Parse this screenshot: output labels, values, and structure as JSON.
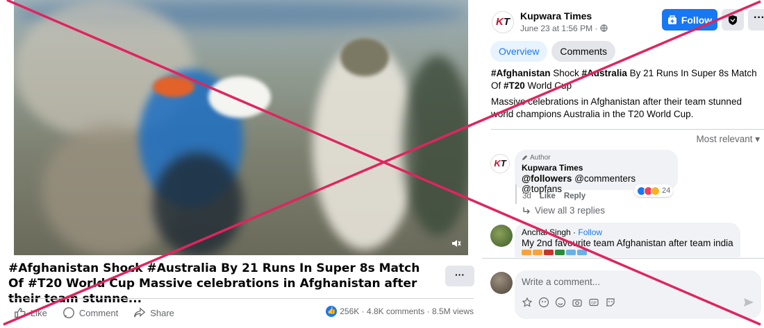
{
  "video": {
    "volume_icon": "speaker-muted-icon"
  },
  "post": {
    "title": "#Afghanistan Shock #Australia By 21 Runs In Super 8s Match Of #T20 World Cup Massive celebrations in Afghanistan after their team stunne...",
    "more_label": "···",
    "actions": {
      "like": "Like",
      "comment": "Comment",
      "share": "Share"
    },
    "stats": "256K · 4.8K comments · 8.5M views"
  },
  "panel": {
    "page_name": "Kupwara Times",
    "logo_text_k": "K",
    "logo_text_t": "T",
    "post_meta": "June 23 at 1:56 PM · ",
    "follow_label": "Follow",
    "dots_label": "···",
    "tabs": [
      "Overview",
      "Comments"
    ],
    "headline_parts": [
      "#Afghanistan",
      " Shock ",
      "#Australia",
      " By 21 Runs In Super 8s Match Of ",
      "#T20",
      " World Cup"
    ],
    "description": "Massive celebrations in Afghanistan after their team stunned world champions Australia in the T20 World Cup.",
    "sort_label": "Most relevant ▾",
    "comments": [
      {
        "author_tag": "Author",
        "name": "Kupwara Times",
        "mention_bold": "@followers",
        "mention_rest": " @commenters @topfans",
        "reaction_count": "24",
        "time": "3d",
        "like": "Like",
        "reply": "Reply",
        "view_replies": "View all 3 replies"
      },
      {
        "name": "Anchal Singh",
        "follow": "Follow",
        "sep": " · ",
        "text": "My 2nd favourite team Afghanistan after team india"
      }
    ],
    "comment_placeholder": "Write a comment..."
  },
  "colors": {
    "brand_blue": "#1877f2",
    "x_overlay": "#e0245e"
  }
}
